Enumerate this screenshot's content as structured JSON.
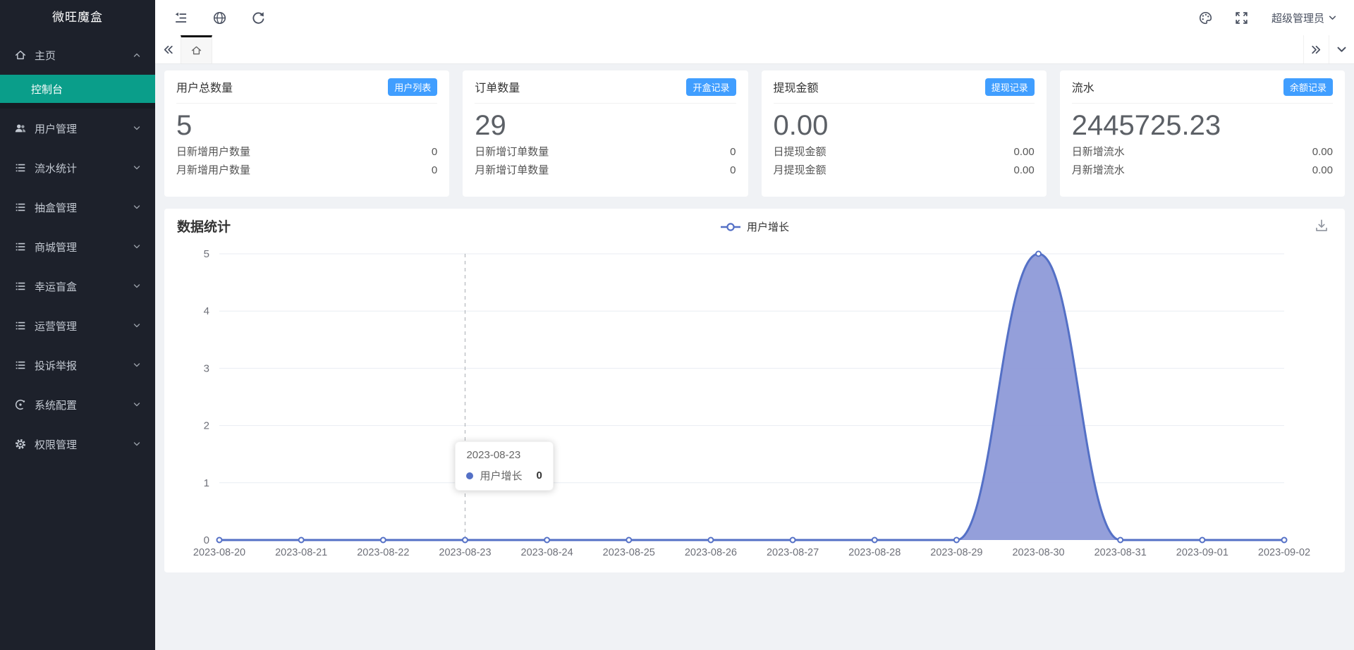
{
  "brand": "微旺魔盒",
  "topbar": {
    "user_label": "超级管理员",
    "icons": [
      "fold-menu-icon",
      "globe-icon",
      "refresh-icon",
      "palette-icon",
      "fullscreen-icon"
    ]
  },
  "tabbar": {
    "home_tab_icon": "home-icon",
    "nav_icons": [
      "double-chevron-left-icon",
      "double-chevron-right-icon",
      "chevron-down-icon"
    ]
  },
  "sidebar": {
    "items": [
      {
        "label": "主页",
        "icon": "home-icon",
        "state": "expanded"
      },
      {
        "label": "用户管理",
        "icon": "users-icon",
        "state": "collapsed"
      },
      {
        "label": "流水统计",
        "icon": "list-icon",
        "state": "collapsed"
      },
      {
        "label": "抽盒管理",
        "icon": "list-icon",
        "state": "collapsed"
      },
      {
        "label": "商城管理",
        "icon": "list-icon",
        "state": "collapsed"
      },
      {
        "label": "幸运盲盒",
        "icon": "list-icon",
        "state": "collapsed"
      },
      {
        "label": "运营管理",
        "icon": "list-icon",
        "state": "collapsed"
      },
      {
        "label": "投诉举报",
        "icon": "list-icon",
        "state": "collapsed"
      },
      {
        "label": "系统配置",
        "icon": "dial-icon",
        "state": "collapsed"
      },
      {
        "label": "权限管理",
        "icon": "gear-icon",
        "state": "collapsed"
      }
    ],
    "console": {
      "label": "控制台",
      "active": true
    }
  },
  "cards": [
    {
      "title": "用户总数量",
      "badge": "用户列表",
      "value": "5",
      "rows": [
        {
          "label": "日新增用户数量",
          "value": "0"
        },
        {
          "label": "月新增用户数量",
          "value": "0"
        }
      ]
    },
    {
      "title": "订单数量",
      "badge": "开盒记录",
      "value": "29",
      "rows": [
        {
          "label": "日新增订单数量",
          "value": "0"
        },
        {
          "label": "月新增订单数量",
          "value": "0"
        }
      ]
    },
    {
      "title": "提现金额",
      "badge": "提现记录",
      "value": "0.00",
      "rows": [
        {
          "label": "日提现金额",
          "value": "0.00"
        },
        {
          "label": "月提现金额",
          "value": "0.00"
        }
      ]
    },
    {
      "title": "流水",
      "badge": "余额记录",
      "value": "2445725.23",
      "rows": [
        {
          "label": "日新增流水",
          "value": "0.00"
        },
        {
          "label": "月新增流水",
          "value": "0.00"
        }
      ]
    }
  ],
  "chart": {
    "title": "数据统计",
    "download_icon": "download-icon"
  },
  "chart_data": {
    "type": "area",
    "title": "数据统计",
    "x": [
      "2023-08-20",
      "2023-08-21",
      "2023-08-22",
      "2023-08-23",
      "2023-08-24",
      "2023-08-25",
      "2023-08-26",
      "2023-08-27",
      "2023-08-28",
      "2023-08-29",
      "2023-08-30",
      "2023-08-31",
      "2023-09-01",
      "2023-09-02"
    ],
    "series": [
      {
        "name": "用户增长",
        "values": [
          0,
          0,
          0,
          0,
          0,
          0,
          0,
          0,
          0,
          0,
          5,
          0,
          0,
          0
        ]
      }
    ],
    "ylim": [
      0,
      5
    ],
    "yticks": [
      0,
      1,
      2,
      3,
      4,
      5
    ],
    "grid": true,
    "smooth": true,
    "legend_position": "top-center",
    "tooltip": {
      "date": "2023-08-23",
      "series": "用户增长",
      "value": "0",
      "x_index": 3
    }
  },
  "colors": {
    "sidebar_bg": "#1d212b",
    "sidebar_active": "#0a9e8a",
    "badge_blue": "#409eff",
    "chart_line": "#5470c6",
    "chart_fill": "#8e9ad8",
    "axis_label": "#6e7079",
    "grid_line": "#e9edf3"
  }
}
